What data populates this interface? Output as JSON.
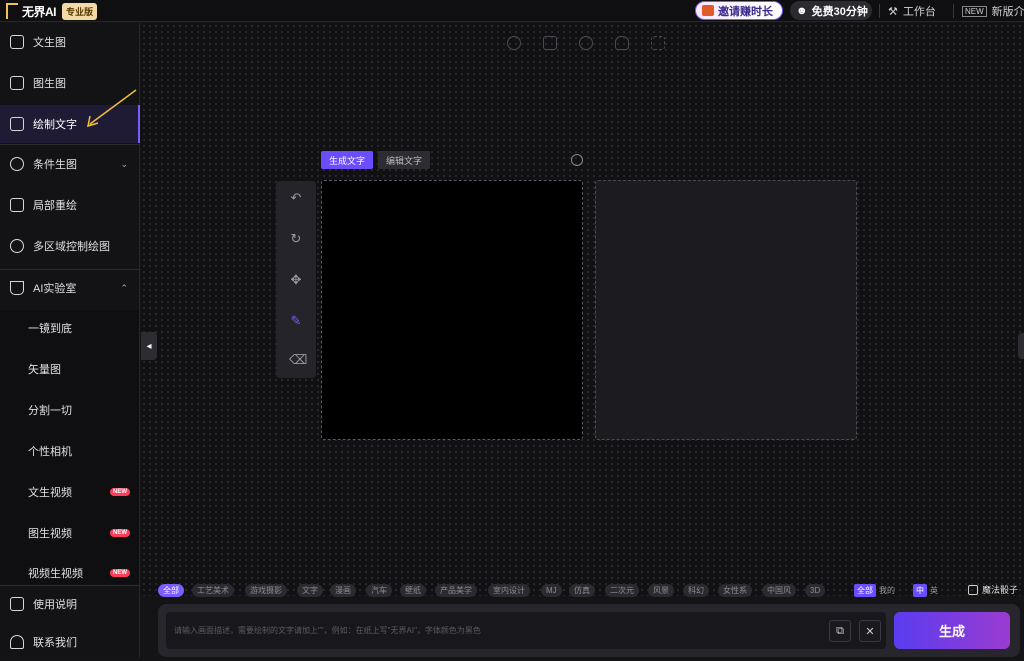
{
  "header": {
    "brand": "无界AI",
    "edition_badge": "专业版",
    "invite_label": "邀请赚时长",
    "free_label": "免费30分钟",
    "workbench_label": "工作台",
    "newver_label": "新版介绍"
  },
  "sidebar": {
    "items": [
      {
        "label": "文生图",
        "icon": "image-icon"
      },
      {
        "label": "图生图",
        "icon": "images-icon"
      },
      {
        "label": "绘制文字",
        "icon": "text-frame-icon",
        "active": true
      },
      {
        "label": "条件生图",
        "icon": "nodes-icon",
        "expand": "collapsed"
      },
      {
        "label": "局部重绘",
        "icon": "repaint-icon"
      },
      {
        "label": "多区域控制绘图",
        "icon": "region-icon"
      },
      {
        "label": "AI实验室",
        "icon": "flask-icon",
        "expand": "expanded"
      }
    ],
    "lab_items": [
      {
        "label": "一镜到底"
      },
      {
        "label": "矢量图"
      },
      {
        "label": "分割一切"
      },
      {
        "label": "个性相机"
      },
      {
        "label": "文生视频",
        "tag": "NEW"
      },
      {
        "label": "图生视频",
        "tag": "NEW"
      },
      {
        "label": "视频生视频",
        "tag": "NEW"
      }
    ],
    "footer_items": [
      {
        "label": "使用说明",
        "icon": "book-icon"
      },
      {
        "label": "联系我们",
        "icon": "headset-icon"
      }
    ]
  },
  "editor": {
    "tab_generate": "生成文字",
    "tab_edit": "编辑文字",
    "tools": [
      "undo-icon",
      "refresh-icon",
      "move-icon",
      "brush-icon",
      "eraser-icon"
    ],
    "top_tools": [
      "globe-icon",
      "grid-icon",
      "face-icon",
      "hand-icon",
      "fullscreen-icon"
    ]
  },
  "styles": {
    "tags": [
      "全部",
      "工艺美术",
      "游戏摄影",
      "文字",
      "漫画",
      "汽车",
      "壁纸",
      "产品美学",
      "室内设计",
      "MJ",
      "仿真",
      "二次元",
      "风景",
      "科幻",
      "女性系",
      "中国风",
      "3D"
    ],
    "toggle1_on": "全部",
    "toggle1_off": "我的",
    "toggle2_on": "中",
    "toggle2_off": "英",
    "magic_label": "魔法骰子"
  },
  "prompt": {
    "placeholder": "请输入画面描述，需要绘制的文字请加上\"\"，例如：在纸上写\"无界AI\"，字体颜色为黑色",
    "generate_label": "生成"
  },
  "colors": {
    "accent": "#7b5cff",
    "generate_gradient_end": "#9a3cd0",
    "new_tag": "#ff3d5a"
  }
}
